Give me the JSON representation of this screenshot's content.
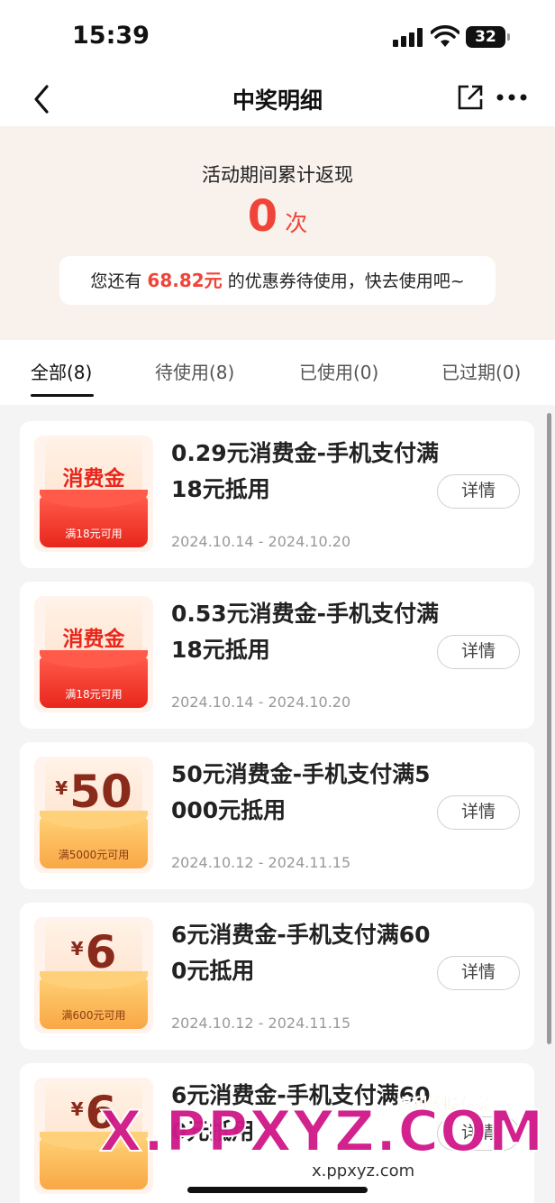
{
  "status": {
    "time": "15:39",
    "battery": "32"
  },
  "nav": {
    "title": "中奖明细"
  },
  "summary": {
    "label": "活动期间累计返现",
    "count": "0",
    "unit": "次",
    "tip_prefix": "您还有",
    "tip_amount": "68.82元",
    "tip_suffix": "的优惠券待使用，快去使用吧~"
  },
  "tabs": [
    {
      "label": "全部(8)",
      "active": true
    },
    {
      "label": "待使用(8)",
      "active": false
    },
    {
      "label": "已使用(0)",
      "active": false
    },
    {
      "label": "已过期(0)",
      "active": false
    }
  ],
  "coupons": [
    {
      "style": "red",
      "badge": "消费金",
      "condition": "满18元可用",
      "title": "0.29元消费金-手机支付满18元抵用",
      "date": "2024.10.14 - 2024.10.20",
      "button": "详情"
    },
    {
      "style": "red",
      "badge": "消费金",
      "condition": "满18元可用",
      "title": "0.53元消费金-手机支付满18元抵用",
      "date": "2024.10.14 - 2024.10.20",
      "button": "详情"
    },
    {
      "style": "orange",
      "currency": "¥",
      "amount": "50",
      "condition": "满5000元可用",
      "title": "50元消费金-手机支付满5000元抵用",
      "date": "2024.10.12 - 2024.11.15",
      "button": "详情"
    },
    {
      "style": "orange",
      "currency": "¥",
      "amount": "6",
      "condition": "满600元可用",
      "title": "6元消费金-手机支付满600元抵用",
      "date": "2024.10.12 - 2024.11.15",
      "button": "详情"
    },
    {
      "style": "orange",
      "currency": "¥",
      "amount": "6",
      "condition": "",
      "title": "6元消费金-手机支付满600元抵用",
      "date": "",
      "button": "详情"
    }
  ],
  "watermark": {
    "main": "X.PPXYZ.COM",
    "badge": "福利线报专家",
    "sub": "x.ppxyz.com"
  },
  "colors": {
    "accent": "#f04438",
    "summary_bg": "#f8f1ec",
    "voucher_red": "#e8261c",
    "voucher_orange": "#f9a745"
  },
  "icons": [
    "back-icon",
    "share-icon",
    "more-icon",
    "signal-icon",
    "wifi-icon",
    "battery-icon"
  ]
}
